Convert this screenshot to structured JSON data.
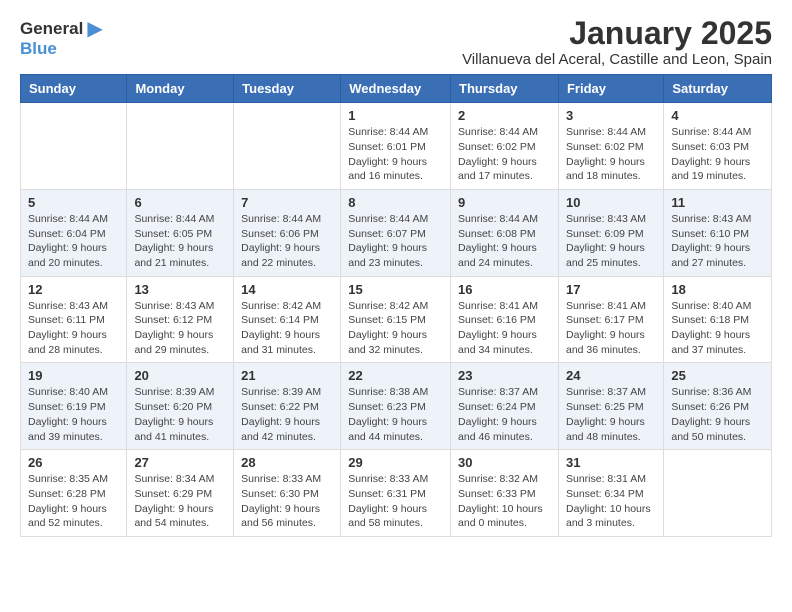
{
  "logo": {
    "general": "General",
    "blue": "Blue"
  },
  "title": "January 2025",
  "subtitle": "Villanueva del Aceral, Castille and Leon, Spain",
  "days": [
    "Sunday",
    "Monday",
    "Tuesday",
    "Wednesday",
    "Thursday",
    "Friday",
    "Saturday"
  ],
  "weeks": [
    [
      {
        "num": "",
        "info": ""
      },
      {
        "num": "",
        "info": ""
      },
      {
        "num": "",
        "info": ""
      },
      {
        "num": "1",
        "info": "Sunrise: 8:44 AM\nSunset: 6:01 PM\nDaylight: 9 hours\nand 16 minutes."
      },
      {
        "num": "2",
        "info": "Sunrise: 8:44 AM\nSunset: 6:02 PM\nDaylight: 9 hours\nand 17 minutes."
      },
      {
        "num": "3",
        "info": "Sunrise: 8:44 AM\nSunset: 6:02 PM\nDaylight: 9 hours\nand 18 minutes."
      },
      {
        "num": "4",
        "info": "Sunrise: 8:44 AM\nSunset: 6:03 PM\nDaylight: 9 hours\nand 19 minutes."
      }
    ],
    [
      {
        "num": "5",
        "info": "Sunrise: 8:44 AM\nSunset: 6:04 PM\nDaylight: 9 hours\nand 20 minutes."
      },
      {
        "num": "6",
        "info": "Sunrise: 8:44 AM\nSunset: 6:05 PM\nDaylight: 9 hours\nand 21 minutes."
      },
      {
        "num": "7",
        "info": "Sunrise: 8:44 AM\nSunset: 6:06 PM\nDaylight: 9 hours\nand 22 minutes."
      },
      {
        "num": "8",
        "info": "Sunrise: 8:44 AM\nSunset: 6:07 PM\nDaylight: 9 hours\nand 23 minutes."
      },
      {
        "num": "9",
        "info": "Sunrise: 8:44 AM\nSunset: 6:08 PM\nDaylight: 9 hours\nand 24 minutes."
      },
      {
        "num": "10",
        "info": "Sunrise: 8:43 AM\nSunset: 6:09 PM\nDaylight: 9 hours\nand 25 minutes."
      },
      {
        "num": "11",
        "info": "Sunrise: 8:43 AM\nSunset: 6:10 PM\nDaylight: 9 hours\nand 27 minutes."
      }
    ],
    [
      {
        "num": "12",
        "info": "Sunrise: 8:43 AM\nSunset: 6:11 PM\nDaylight: 9 hours\nand 28 minutes."
      },
      {
        "num": "13",
        "info": "Sunrise: 8:43 AM\nSunset: 6:12 PM\nDaylight: 9 hours\nand 29 minutes."
      },
      {
        "num": "14",
        "info": "Sunrise: 8:42 AM\nSunset: 6:14 PM\nDaylight: 9 hours\nand 31 minutes."
      },
      {
        "num": "15",
        "info": "Sunrise: 8:42 AM\nSunset: 6:15 PM\nDaylight: 9 hours\nand 32 minutes."
      },
      {
        "num": "16",
        "info": "Sunrise: 8:41 AM\nSunset: 6:16 PM\nDaylight: 9 hours\nand 34 minutes."
      },
      {
        "num": "17",
        "info": "Sunrise: 8:41 AM\nSunset: 6:17 PM\nDaylight: 9 hours\nand 36 minutes."
      },
      {
        "num": "18",
        "info": "Sunrise: 8:40 AM\nSunset: 6:18 PM\nDaylight: 9 hours\nand 37 minutes."
      }
    ],
    [
      {
        "num": "19",
        "info": "Sunrise: 8:40 AM\nSunset: 6:19 PM\nDaylight: 9 hours\nand 39 minutes."
      },
      {
        "num": "20",
        "info": "Sunrise: 8:39 AM\nSunset: 6:20 PM\nDaylight: 9 hours\nand 41 minutes."
      },
      {
        "num": "21",
        "info": "Sunrise: 8:39 AM\nSunset: 6:22 PM\nDaylight: 9 hours\nand 42 minutes."
      },
      {
        "num": "22",
        "info": "Sunrise: 8:38 AM\nSunset: 6:23 PM\nDaylight: 9 hours\nand 44 minutes."
      },
      {
        "num": "23",
        "info": "Sunrise: 8:37 AM\nSunset: 6:24 PM\nDaylight: 9 hours\nand 46 minutes."
      },
      {
        "num": "24",
        "info": "Sunrise: 8:37 AM\nSunset: 6:25 PM\nDaylight: 9 hours\nand 48 minutes."
      },
      {
        "num": "25",
        "info": "Sunrise: 8:36 AM\nSunset: 6:26 PM\nDaylight: 9 hours\nand 50 minutes."
      }
    ],
    [
      {
        "num": "26",
        "info": "Sunrise: 8:35 AM\nSunset: 6:28 PM\nDaylight: 9 hours\nand 52 minutes."
      },
      {
        "num": "27",
        "info": "Sunrise: 8:34 AM\nSunset: 6:29 PM\nDaylight: 9 hours\nand 54 minutes."
      },
      {
        "num": "28",
        "info": "Sunrise: 8:33 AM\nSunset: 6:30 PM\nDaylight: 9 hours\nand 56 minutes."
      },
      {
        "num": "29",
        "info": "Sunrise: 8:33 AM\nSunset: 6:31 PM\nDaylight: 9 hours\nand 58 minutes."
      },
      {
        "num": "30",
        "info": "Sunrise: 8:32 AM\nSunset: 6:33 PM\nDaylight: 10 hours\nand 0 minutes."
      },
      {
        "num": "31",
        "info": "Sunrise: 8:31 AM\nSunset: 6:34 PM\nDaylight: 10 hours\nand 3 minutes."
      },
      {
        "num": "",
        "info": ""
      }
    ]
  ]
}
